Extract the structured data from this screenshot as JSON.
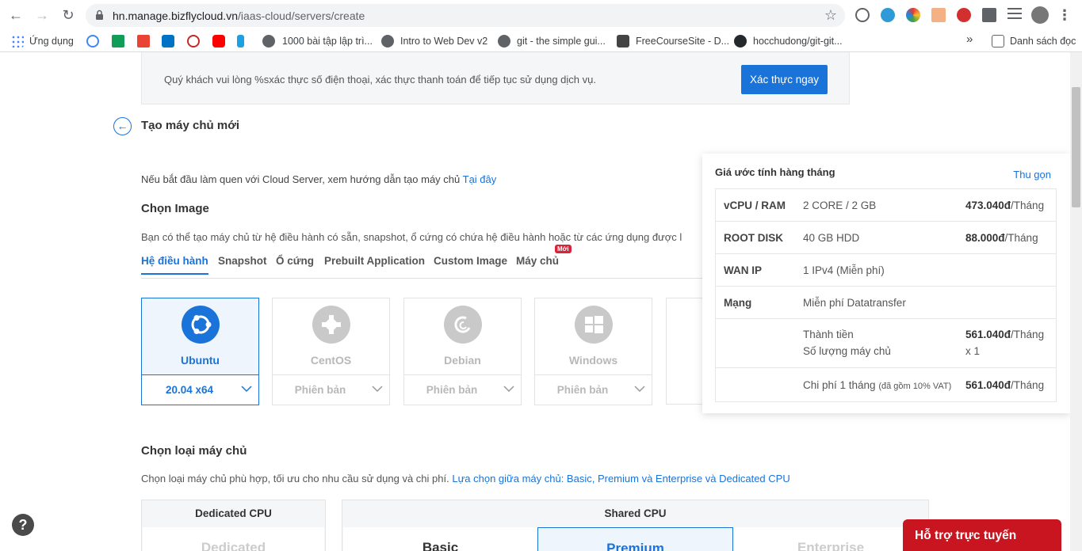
{
  "browser": {
    "url_host": "hn.manage.bizflycloud.vn",
    "url_path": "/iaas-cloud/servers/create",
    "bookmarks": [
      {
        "label": "Ứng dụng"
      },
      {
        "label": "1000 bài tập lập trì..."
      },
      {
        "label": "Intro to Web Dev v2"
      },
      {
        "label": "git - the simple gui..."
      },
      {
        "label": "FreeCourseSite - D..."
      },
      {
        "label": "hocchudong/git-git..."
      }
    ],
    "overflow_label": "»",
    "reading_list_label": "Danh sách đọc"
  },
  "banner": {
    "message": "Quý khách vui lòng %sxác thực số điện thoại, xác thực thanh toán để tiếp tục sử dụng dịch vụ.",
    "button": "Xác thực ngay"
  },
  "page": {
    "title": "Tạo máy chủ mới",
    "guide_text": "Nếu bắt đầu làm quen với Cloud Server, xem hướng dẫn tạo máy chủ ",
    "guide_link": "Tại đây"
  },
  "image_section": {
    "title": "Chọn Image",
    "description": "Bạn có thể tạo máy chủ từ hệ điều hành có sẵn, snapshot, ổ cứng có chứa hệ điều hành hoặc từ các ứng dụng được l",
    "tabs": [
      {
        "label": "Hệ điều hành",
        "active": true
      },
      {
        "label": "Snapshot"
      },
      {
        "label": "Ổ cứng"
      },
      {
        "label": "Prebuilt Application"
      },
      {
        "label": "Custom Image"
      },
      {
        "label": "Máy chủ",
        "badge": "Mới"
      }
    ],
    "os": [
      {
        "name": "Ubuntu",
        "version": "20.04 x64",
        "icon": "ubuntu-icon",
        "active": true
      },
      {
        "name": "CentOS",
        "version": "Phiên bản",
        "icon": "centos-icon"
      },
      {
        "name": "Debian",
        "version": "Phiên bản",
        "icon": "debian-icon"
      },
      {
        "name": "Windows",
        "version": "Phiên bản",
        "icon": "windows-icon"
      }
    ]
  },
  "server_type_section": {
    "title": "Chọn loại máy chủ",
    "description": "Chọn loại máy chủ phù hợp, tối ưu cho nhu cầu sử dụng và chi phí. ",
    "link": "Lựa chọn giữa máy chủ: Basic, Premium và Enterprise và Dedicated CPU",
    "groups": [
      {
        "label": "Dedicated CPU",
        "options": [
          "Dedicated"
        ]
      },
      {
        "label": "Shared CPU",
        "options": [
          "Basic",
          "Premium",
          "Enterprise"
        ]
      }
    ]
  },
  "pricing": {
    "title": "Giá ước tính hàng tháng",
    "collapse": "Thu gọn",
    "rows": [
      {
        "key": "vCPU / RAM",
        "value": "2 CORE / 2 GB",
        "price": "473.040đ",
        "unit": "/Tháng"
      },
      {
        "key": "ROOT DISK",
        "value": "40 GB HDD",
        "price": "88.000đ",
        "unit": "/Tháng"
      },
      {
        "key": "WAN IP",
        "value": "1 IPv4 (Miễn phí)",
        "price": "",
        "unit": ""
      },
      {
        "key": "Mạng",
        "value": "Miễn phí Datatransfer",
        "price": "",
        "unit": ""
      }
    ],
    "total_label": "Thành tiền",
    "total_price": "561.040đ",
    "total_unit": "/Tháng",
    "qty_label": "Số lượng máy chủ",
    "qty_value": "x 1",
    "monthly_label": "Chi phí 1 tháng",
    "monthly_note": "(đã gồm 10% VAT)",
    "monthly_price": "561.040đ",
    "monthly_unit": "/Tháng"
  },
  "support": {
    "label": "Hỗ trợ trực tuyến",
    "help": "?"
  }
}
